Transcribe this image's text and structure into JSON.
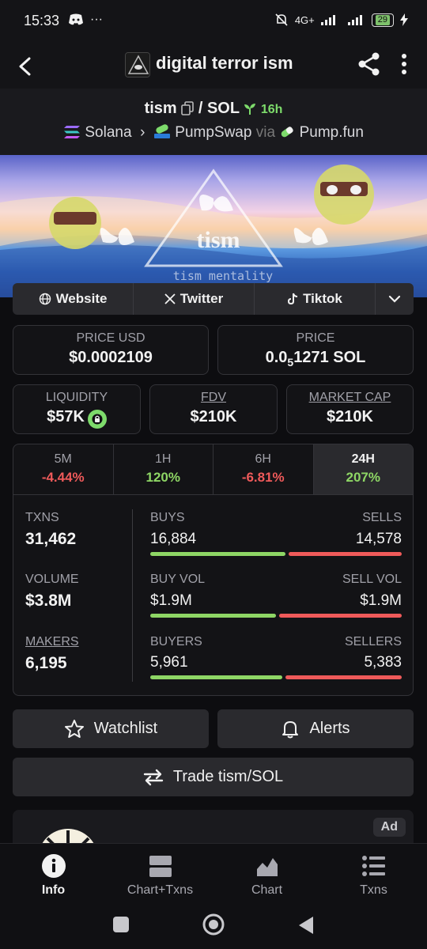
{
  "status": {
    "time": "15:33",
    "network": "4G+",
    "battery": "29"
  },
  "header": {
    "title": "digital terror ism"
  },
  "pair": {
    "base": "tism",
    "separator": "/",
    "quote": "SOL",
    "age": "16h"
  },
  "route": {
    "chain": "Solana",
    "dex": "PumpSwap",
    "via": "via",
    "launchpad": "Pump.fun"
  },
  "banner": {
    "overlay_text": "tism",
    "caption": "tism mentality"
  },
  "links": {
    "website": "Website",
    "twitter": "Twitter",
    "tiktok": "Tiktok"
  },
  "price": {
    "usd_label": "PRICE USD",
    "usd_value": "$0.0002109",
    "native_label": "PRICE",
    "native_prefix": "0.0",
    "native_sub": "5",
    "native_rest": "1271 SOL"
  },
  "metrics": {
    "liquidity_label": "LIQUIDITY",
    "liquidity_value": "$57K",
    "fdv_label": "FDV",
    "fdv_value": "$210K",
    "mcap_label": "MARKET CAP",
    "mcap_value": "$210K"
  },
  "timeframes": [
    {
      "name": "5M",
      "change": "-4.44%"
    },
    {
      "name": "1H",
      "change": "120%"
    },
    {
      "name": "6H",
      "change": "-6.81%"
    },
    {
      "name": "24H",
      "change": "207%"
    }
  ],
  "stats": {
    "txns_label": "TXNS",
    "txns": "31,462",
    "buys_label": "BUYS",
    "buys": "16,884",
    "sells_label": "SELLS",
    "sells": "14,578",
    "volume_label": "VOLUME",
    "volume": "$3.8M",
    "buy_vol_label": "BUY VOL",
    "buy_vol": "$1.9M",
    "sell_vol_label": "SELL VOL",
    "sell_vol": "$1.9M",
    "makers_label": "MAKERS",
    "makers": "6,195",
    "buyers_label": "BUYERS",
    "buyers": "5,961",
    "sellers_label": "SELLERS",
    "sellers": "5,383",
    "buy_ratio_txns": 0.537,
    "buy_ratio_vol": 0.5,
    "buy_ratio_makers": 0.526
  },
  "actions": {
    "watchlist": "Watchlist",
    "alerts": "Alerts",
    "trade": "Trade tism/SOL"
  },
  "ad": {
    "badge": "Ad"
  },
  "nav": {
    "info": "Info",
    "chart_txns": "Chart+Txns",
    "chart": "Chart",
    "txns": "Txns"
  },
  "colors": {
    "positive": "#8ed665",
    "negative": "#ef5a5a",
    "card_bg": "#131316"
  }
}
